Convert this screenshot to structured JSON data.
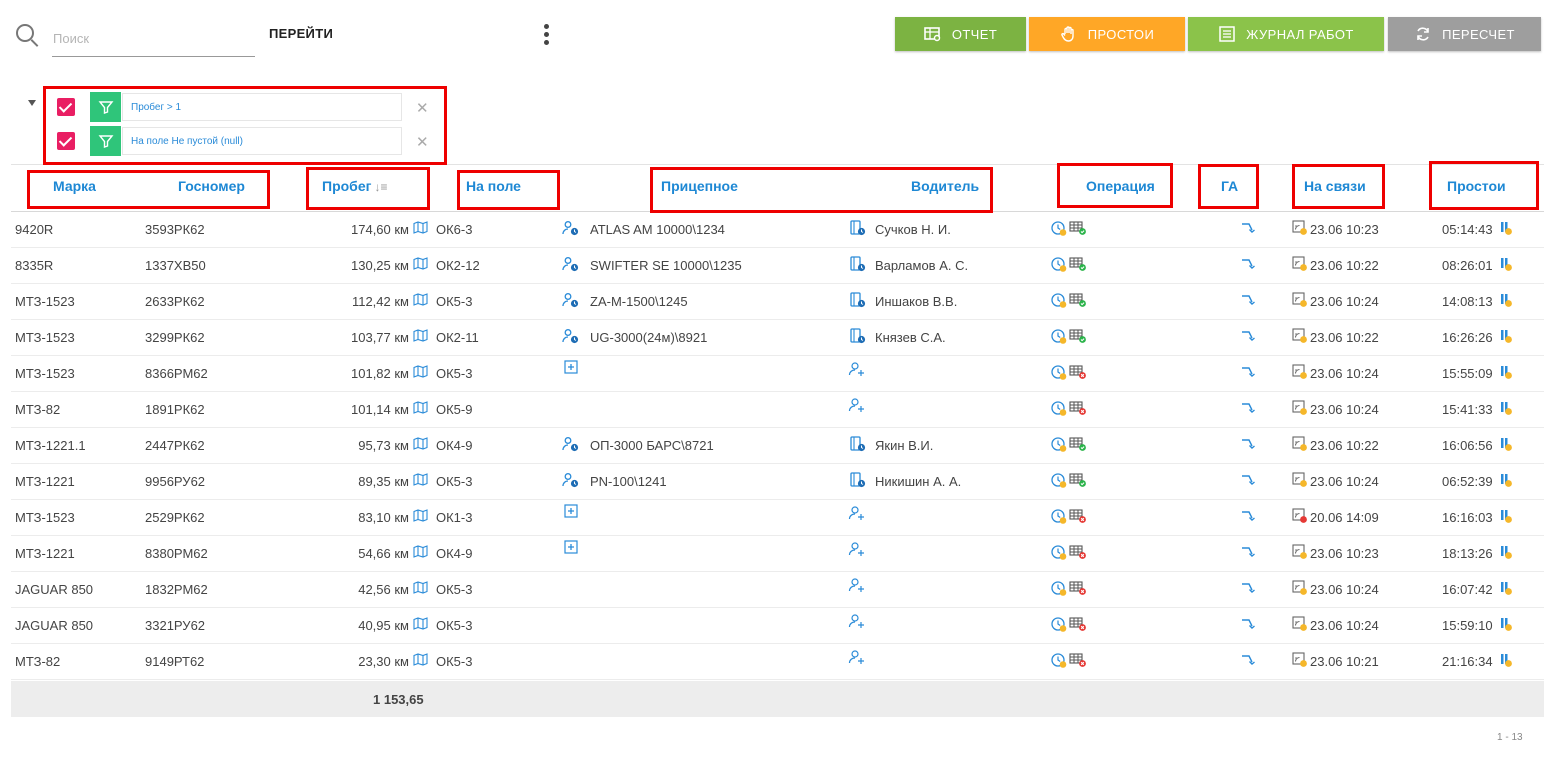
{
  "toolbar": {
    "search_placeholder": "Поиск",
    "goto_label": "ПЕРЕЙТИ",
    "report_label": "ОТЧЕТ",
    "idle_label": "ПРОСТОИ",
    "log_label": "ЖУРНАЛ РАБОТ",
    "recalc_label": "ПЕРЕСЧЕТ"
  },
  "colors": {
    "report": "#7cb342",
    "idle": "#ffa726",
    "log": "#8bc34a",
    "recalc": "#9e9e9e",
    "header": "#1e88d4",
    "checkbox": "#e91e63",
    "filter_badge": "#2fc57a",
    "annotation": "#ee0000"
  },
  "filters": [
    {
      "label": "Пробег > 1",
      "checked": true
    },
    {
      "label": "На поле Не пустой (null)",
      "checked": true
    }
  ],
  "columns": {
    "brand": "Марка",
    "plate": "Госномер",
    "mileage": "Пробег",
    "field": "На поле",
    "trailer": "Прицепное",
    "driver": "Водитель",
    "operation": "Операция",
    "ga": "ГА",
    "online": "На связи",
    "idle": "Простои"
  },
  "rows": [
    {
      "brand": "9420R",
      "plate": "3593РК62",
      "mileage": "174,60 км",
      "field": "ОК6-3",
      "trailer": "ATLAS AM 10000\\1234",
      "driver": "Сучков Н. И.",
      "op_ok": true,
      "online": "23.06 10:23",
      "online_ok": true,
      "idle": "05:14:43"
    },
    {
      "brand": "8335R",
      "plate": "1337ХВ50",
      "mileage": "130,25 км",
      "field": "ОК2-12",
      "trailer": "SWIFTER SE 10000\\1235",
      "driver": "Варламов А. С.",
      "op_ok": true,
      "online": "23.06 10:22",
      "online_ok": true,
      "idle": "08:26:01"
    },
    {
      "brand": "МТЗ-1523",
      "plate": "2633РК62",
      "mileage": "112,42 км",
      "field": "ОК5-3",
      "trailer": "ZA-M-1500\\1245",
      "driver": "Иншаков В.В.",
      "op_ok": true,
      "online": "23.06 10:24",
      "online_ok": true,
      "idle": "14:08:13"
    },
    {
      "brand": "МТЗ-1523",
      "plate": "3299РК62",
      "mileage": "103,77 км",
      "field": "ОК2-11",
      "trailer": "UG-3000(24м)\\8921",
      "driver": "Князев С.А.",
      "op_ok": true,
      "online": "23.06 10:22",
      "online_ok": true,
      "idle": "16:26:26"
    },
    {
      "brand": "МТЗ-1523",
      "plate": "8366РМ62",
      "mileage": "101,82 км",
      "field": "ОК5-3",
      "trailer": "",
      "driver": "",
      "op_ok": false,
      "online": "23.06 10:24",
      "online_ok": true,
      "idle": "15:55:09",
      "trailer_add": true
    },
    {
      "brand": "МТЗ-82",
      "plate": "1891РК62",
      "mileage": "101,14 км",
      "field": "ОК5-9",
      "trailer": "",
      "driver": "",
      "op_ok": false,
      "online": "23.06 10:24",
      "online_ok": true,
      "idle": "15:41:33",
      "trailer_add": false
    },
    {
      "brand": "МТЗ-1221.1",
      "plate": "2447РК62",
      "mileage": "95,73 км",
      "field": "ОК4-9",
      "trailer": "ОП-3000 БАРС\\8721",
      "driver": "Якин В.И.",
      "op_ok": true,
      "online": "23.06 10:22",
      "online_ok": true,
      "idle": "16:06:56"
    },
    {
      "brand": "МТЗ-1221",
      "plate": "9956РУ62",
      "mileage": "89,35 км",
      "field": "ОК5-3",
      "trailer": "PN-100\\1241",
      "driver": "Никишин А. А.",
      "op_ok": true,
      "online": "23.06 10:24",
      "online_ok": true,
      "idle": "06:52:39"
    },
    {
      "brand": "МТЗ-1523",
      "plate": "2529РК62",
      "mileage": "83,10 км",
      "field": "ОК1-3",
      "trailer": "",
      "driver": "",
      "op_ok": false,
      "online": "20.06 14:09",
      "online_ok": false,
      "idle": "16:16:03",
      "trailer_add": true
    },
    {
      "brand": "МТЗ-1221",
      "plate": "8380РМ62",
      "mileage": "54,66 км",
      "field": "ОК4-9",
      "trailer": "",
      "driver": "",
      "op_ok": false,
      "online": "23.06 10:23",
      "online_ok": true,
      "idle": "18:13:26",
      "trailer_add": true
    },
    {
      "brand": "JAGUAR 850",
      "plate": "1832РМ62",
      "mileage": "42,56 км",
      "field": "ОК5-3",
      "trailer": "",
      "driver": "",
      "op_ok": false,
      "online": "23.06 10:24",
      "online_ok": true,
      "idle": "16:07:42",
      "trailer_add": false
    },
    {
      "brand": "JAGUAR 850",
      "plate": "3321РУ62",
      "mileage": "40,95 км",
      "field": "ОК5-3",
      "trailer": "",
      "driver": "",
      "op_ok": false,
      "online": "23.06 10:24",
      "online_ok": true,
      "idle": "15:59:10",
      "trailer_add": false
    },
    {
      "brand": "МТЗ-82",
      "plate": "9149РТ62",
      "mileage": "23,30 км",
      "field": "ОК5-3",
      "trailer": "",
      "driver": "",
      "op_ok": false,
      "online": "23.06 10:21",
      "online_ok": true,
      "idle": "21:16:34",
      "trailer_add": false
    }
  ],
  "total_mileage": "1 153,65",
  "pager": "1 - 13"
}
